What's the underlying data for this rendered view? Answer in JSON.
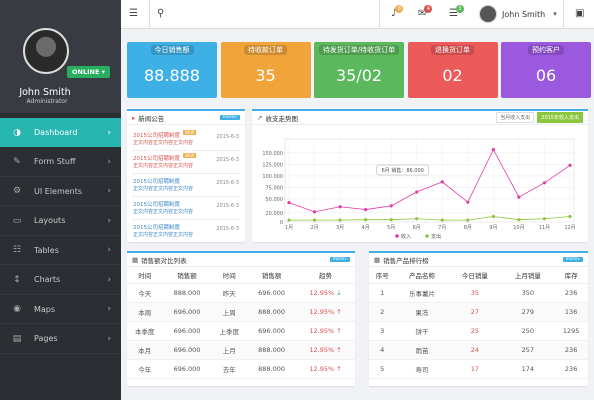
{
  "sidebar": {
    "user_name": "John Smith",
    "user_role": "Administrator",
    "status": "ONLINE ▾",
    "items": [
      {
        "label": "Dashboard",
        "icon": "◑"
      },
      {
        "label": "Form Stuff",
        "icon": "✎"
      },
      {
        "label": "UI Elements",
        "icon": "⚙"
      },
      {
        "label": "Layouts",
        "icon": "▭"
      },
      {
        "label": "Tables",
        "icon": "☷"
      },
      {
        "label": "Charts",
        "icon": "↕"
      },
      {
        "label": "Maps",
        "icon": "◉"
      },
      {
        "label": "Pages",
        "icon": "▤"
      }
    ],
    "chevron": "›"
  },
  "topbar": {
    "menu_icon": "☰",
    "search_icon": "⚲",
    "bell_icon": "♪",
    "bell_badge": "8",
    "mail_icon": "✉",
    "mail_badge": "4",
    "tasks_icon": "☰",
    "tasks_badge": "3",
    "user_name": "John Smith",
    "caret": "▾",
    "chat_icon": "▣"
  },
  "cards": [
    {
      "title": "今日销售额",
      "value": "88.888",
      "color": "#3fb0e6"
    },
    {
      "title": "待收款订单",
      "value": "35",
      "color": "#f0a43a"
    },
    {
      "title": "待发货订单/待收货订单",
      "value": "35/02",
      "color": "#5cb85c"
    },
    {
      "title": "退换货订单",
      "value": "02",
      "color": "#ec5a5a"
    },
    {
      "title": "预约客户",
      "value": "06",
      "color": "#9b59e0"
    }
  ],
  "news": {
    "title": "新闻公告",
    "more": "more»",
    "items": [
      {
        "title": "2015公司招聘制度",
        "sub": "正文内容正文内容正文内容",
        "date": "2015-6-3",
        "new": "NEW",
        "blue": false
      },
      {
        "title": "2015公司招聘制度",
        "sub": "正文内容正文内容正文内容",
        "date": "2015-6-3",
        "new": "NEW",
        "blue": false
      },
      {
        "title": "2015公司招聘制度",
        "sub": "正文内容正文内容正文内容",
        "date": "2015-6-3",
        "new": "",
        "blue": true
      },
      {
        "title": "2015公司招聘制度",
        "sub": "正文内容正文内容正文内容",
        "date": "2015-6-3",
        "new": "",
        "blue": true
      },
      {
        "title": "2015公司招聘制度",
        "sub": "正文内容正文内容正文内容",
        "date": "2015-6-3",
        "new": "",
        "blue": true
      }
    ]
  },
  "chart_panel": {
    "title": "收支走势图",
    "tag1": "当月收入支出",
    "tag2": "2015年收入支出",
    "tooltip": "6月 销售：86.000"
  },
  "chart_data": {
    "type": "line",
    "categories": [
      "1月",
      "2月",
      "3月",
      "4月",
      "5月",
      "6月",
      "7月",
      "8月",
      "9月",
      "10月",
      "11月",
      "12月"
    ],
    "series": [
      {
        "name": "收入",
        "values": [
          42000,
          22000,
          33000,
          27000,
          35000,
          65000,
          87000,
          43000,
          157000,
          54000,
          85000,
          123000
        ],
        "color": "#e33aa4"
      },
      {
        "name": "支出",
        "values": [
          4000,
          4000,
          4000,
          5000,
          5000,
          7000,
          4000,
          4000,
          12000,
          5000,
          7000,
          12000
        ],
        "color": "#8cc63f"
      }
    ],
    "yticks": [
      "0",
      "20.000",
      "50.000",
      "75.000",
      "100.000",
      "125.000",
      "150.000"
    ],
    "ylim": [
      0,
      180000
    ],
    "grid": true,
    "legend": "bottom"
  },
  "sales_table": {
    "title": "销售额对比列表",
    "more": "more»",
    "headers": [
      "时间",
      "销售额",
      "时间",
      "销售额",
      "趋势"
    ],
    "rows": [
      [
        "今天",
        "888.000",
        "昨天",
        "696.000",
        "12.95%",
        "↓",
        "down"
      ],
      [
        "本周",
        "696.000",
        "上周",
        "888.000",
        "12.95%",
        "↑",
        "up"
      ],
      [
        "本季度",
        "696.000",
        "上季度",
        "696.000",
        "12.95%",
        "↑",
        "up"
      ],
      [
        "本月",
        "696.000",
        "上月",
        "888.000",
        "12.95%",
        "↑",
        "up"
      ],
      [
        "今年",
        "696.000",
        "去年",
        "888.000",
        "12.95%",
        "↑",
        "up"
      ]
    ]
  },
  "rank_table": {
    "title": "销售产品排行榜",
    "more": "more»",
    "headers": [
      "序号",
      "产品名称",
      "今日销量",
      "上月销量",
      "库存"
    ],
    "rows": [
      [
        "1",
        "乐事薯片",
        "35",
        "350",
        "236"
      ],
      [
        "2",
        "果冻",
        "27",
        "279",
        "136"
      ],
      [
        "3",
        "饼干",
        "25",
        "250",
        "1295"
      ],
      [
        "4",
        "雨苗",
        "24",
        "257",
        "236"
      ],
      [
        "5",
        "寿司",
        "17",
        "174",
        "236"
      ]
    ]
  }
}
